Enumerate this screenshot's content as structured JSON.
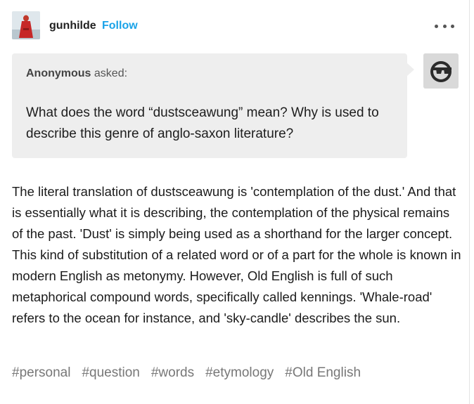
{
  "header": {
    "username": "gunhilde",
    "follow_label": "Follow"
  },
  "ask": {
    "asker_name": "Anonymous",
    "asked_label": "asked:",
    "question": "What does the word “dustsceawung” mean? Why is used to describe this genre of anglo-saxon literature?"
  },
  "answer": {
    "text": "The literal translation of dustsceawung is 'contemplation of the dust.' And that is essentially what it is describing, the contemplation of the physical remains of the past. 'Dust' is simply being used as a shorthand for the larger concept. This kind of substitution of a related word or of a part for the whole is known in modern English as metonymy. However, Old English is full of such metaphorical compound words, specifically called kennings. 'Whale-road' refers to the ocean for instance, and 'sky-candle' describes the sun."
  },
  "tags": [
    "#personal",
    "#question",
    "#words",
    "#etymology",
    "#Old English"
  ],
  "colors": {
    "follow": "#1aa3e8",
    "ask_bg": "#eeeeee",
    "tag": "#777777"
  }
}
